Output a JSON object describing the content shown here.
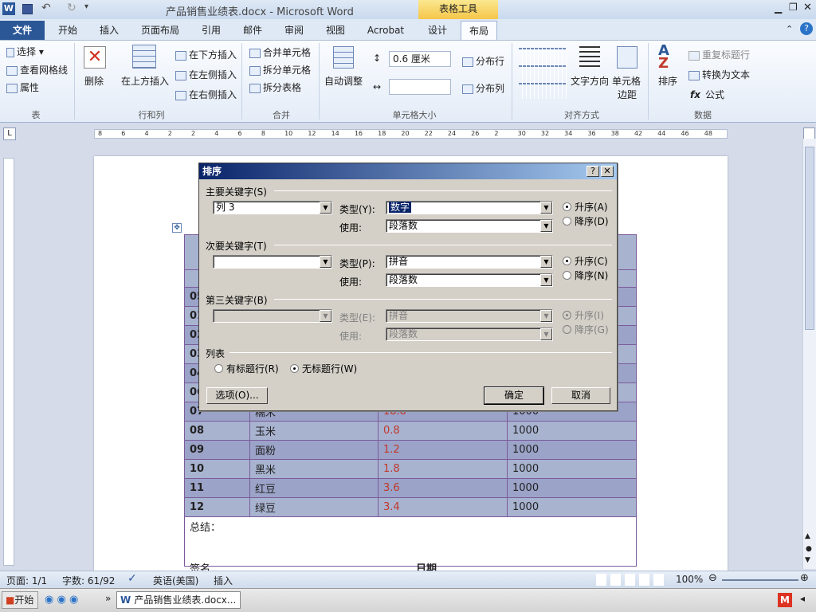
{
  "window": {
    "title": "产品销售业绩表.docx - Microsoft Word",
    "context_group": "表格工具"
  },
  "tabs": [
    "文件",
    "开始",
    "插入",
    "页面布局",
    "引用",
    "邮件",
    "审阅",
    "视图",
    "Acrobat",
    "设计",
    "布局"
  ],
  "ribbon": {
    "table_group": {
      "label": "表",
      "select": "选择",
      "gridlines": "查看网格线",
      "properties": "属性"
    },
    "rows_cols_group": {
      "label": "行和列",
      "delete": "删除",
      "insert_above": "在上方插入",
      "insert_below": "在下方插入",
      "insert_left": "在左侧插入",
      "insert_right": "在右侧插入"
    },
    "merge_group": {
      "label": "合并",
      "merge_cells": "合并单元格",
      "split_cells": "拆分单元格",
      "split_table": "拆分表格"
    },
    "cell_size_group": {
      "label": "单元格大小",
      "autofit": "自动调整",
      "height_value": "0.6 厘米",
      "dist_rows": "分布行",
      "dist_cols": "分布列"
    },
    "align_group": {
      "label": "对齐方式",
      "text_direction": "文字方向",
      "cell_margins_1": "单元格",
      "cell_margins_2": "边距"
    },
    "data_group": {
      "label": "数据",
      "sort": "排序",
      "repeat_header": "重复标题行",
      "convert_text": "转换为文本",
      "formula": "公式"
    }
  },
  "ruler": {
    "ticks": [
      "8",
      "6",
      "4",
      "2",
      "2",
      "4",
      "6",
      "8",
      "10",
      "12",
      "14",
      "16",
      "18",
      "20",
      "22",
      "24",
      "26",
      "2",
      "30",
      "32",
      "34",
      "36",
      "38",
      "42",
      "44",
      "46",
      "48"
    ]
  },
  "table": {
    "rows": [
      {
        "id": "07",
        "name": "糯米",
        "price": "18.8",
        "qty": "1000"
      },
      {
        "id": "08",
        "name": "玉米",
        "price": "0.8",
        "qty": "1000"
      },
      {
        "id": "09",
        "name": "面粉",
        "price": "1.2",
        "qty": "1000"
      },
      {
        "id": "10",
        "name": "黑米",
        "price": "1.8",
        "qty": "1000"
      },
      {
        "id": "11",
        "name": "红豆",
        "price": "3.6",
        "qty": "1000"
      },
      {
        "id": "12",
        "name": "绿豆",
        "price": "3.4",
        "qty": "1000"
      }
    ],
    "hidden_ids": [
      "05",
      "01",
      "02",
      "03",
      "04",
      "06"
    ],
    "summary_label": "总结：",
    "signature_label": "签名",
    "date_label": "日期"
  },
  "dialog": {
    "title": "排序",
    "help": "?",
    "close": "✕",
    "primary": {
      "label": "主要关键字(S)",
      "key_value": "列 3",
      "type_label": "类型(Y):",
      "type_value": "数字",
      "use_label": "使用:",
      "use_value": "段落数",
      "asc": "升序(A)",
      "desc": "降序(D)"
    },
    "secondary": {
      "label": "次要关键字(T)",
      "key_value": "",
      "type_label": "类型(P):",
      "type_value": "拼音",
      "use_label": "使用:",
      "use_value": "段落数",
      "asc": "升序(C)",
      "desc": "降序(N)"
    },
    "third": {
      "label": "第三关键字(B)",
      "key_value": "",
      "type_label": "类型(E):",
      "type_value": "拼音",
      "use_label": "使用:",
      "use_value": "段落数",
      "asc": "升序(I)",
      "desc": "降序(G)"
    },
    "list": {
      "label": "列表",
      "has_header": "有标题行(R)",
      "no_header": "无标题行(W)"
    },
    "options_button": "选项(O)...",
    "ok_button": "确定",
    "cancel_button": "取消"
  },
  "statusbar": {
    "page": "页面: 1/1",
    "words": "字数: 61/92",
    "language": "英语(美国)",
    "mode": "插入",
    "zoom": "100%"
  },
  "taskbar": {
    "start": "开始",
    "task_item": "产品销售业绩表.docx..."
  }
}
